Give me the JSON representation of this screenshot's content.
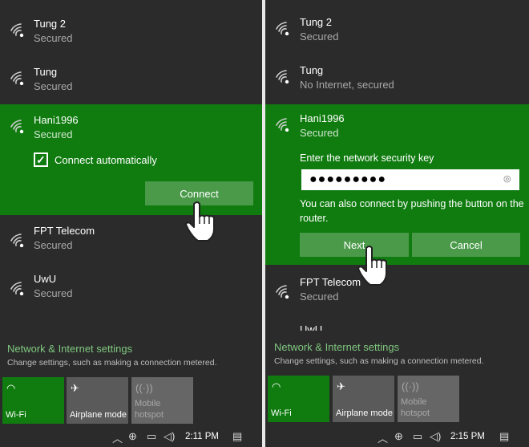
{
  "left": {
    "networks": [
      {
        "name": "Tung 2",
        "status": "Secured"
      },
      {
        "name": "Tung",
        "status": "Secured"
      },
      {
        "name": "Hani1996",
        "status": "Secured"
      },
      {
        "name": "FPT Telecom",
        "status": "Secured"
      },
      {
        "name": "UwU",
        "status": "Secured"
      }
    ],
    "connect_auto_label": "Connect automatically",
    "connect_auto_checked": true,
    "connect_button": "Connect",
    "settings_title": "Network & Internet settings",
    "settings_sub": "Change settings, such as making a connection metered.",
    "tiles": [
      {
        "label": "Wi-Fi",
        "icon": "wifi-icon",
        "state": "on"
      },
      {
        "label": "Airplane mode",
        "icon": "airplane-icon",
        "state": "off"
      },
      {
        "label": "Mobile hotspot",
        "icon": "hotspot-icon",
        "state": "disabled"
      }
    ],
    "time": "2:11 PM"
  },
  "right": {
    "networks": [
      {
        "name": "Tung 2",
        "status": "Secured"
      },
      {
        "name": "Tung",
        "status": "No Internet, secured"
      },
      {
        "name": "Hani1996",
        "status": "Secured"
      },
      {
        "name": "FPT Telecom",
        "status": "Secured"
      },
      {
        "name": "UwU",
        "status": ""
      }
    ],
    "key_label": "Enter the network security key",
    "key_value": "●●●●●●●●●",
    "wps_hint": "You can also connect by pushing the button on the router.",
    "next_button": "Next",
    "cancel_button": "Cancel",
    "settings_title": "Network & Internet settings",
    "settings_sub": "Change settings, such as making a connection metered.",
    "tiles": [
      {
        "label": "Wi-Fi",
        "icon": "wifi-icon",
        "state": "on"
      },
      {
        "label": "Airplane mode",
        "icon": "airplane-icon",
        "state": "off"
      },
      {
        "label": "Mobile hotspot",
        "icon": "hotspot-icon",
        "state": "disabled"
      }
    ],
    "time": "2:15 PM"
  },
  "colors": {
    "accent": "#107c10",
    "background": "#2b2b2b",
    "link": "#7fc77f"
  }
}
